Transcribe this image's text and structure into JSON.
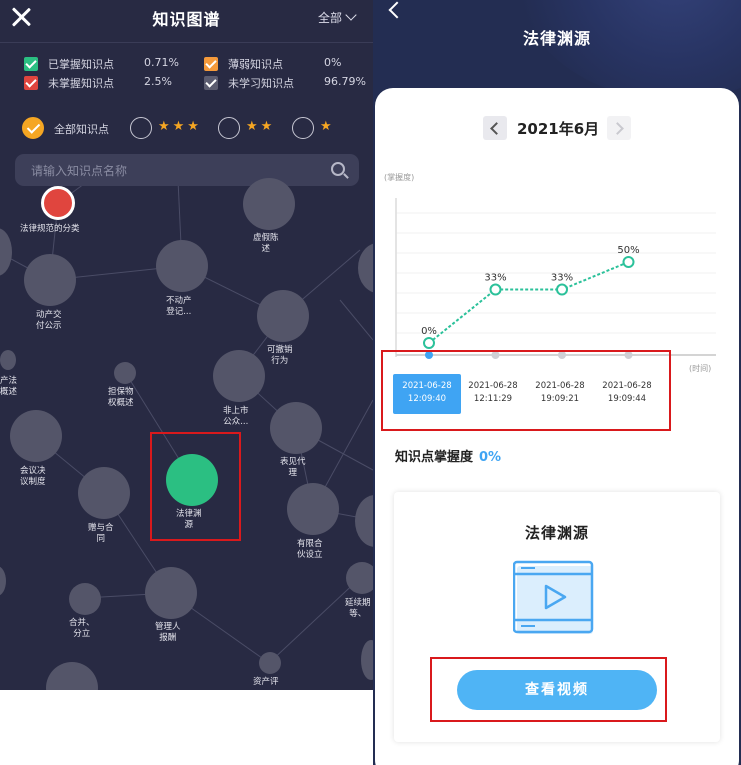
{
  "left": {
    "title": "知识图谱",
    "filter": "全部",
    "legend": [
      {
        "label": "已掌握知识点",
        "pct": "0.71%",
        "color": "#2bbf82"
      },
      {
        "label": "薄弱知识点",
        "pct": "0%",
        "color": "#f59a3b"
      },
      {
        "label": "未掌握知识点",
        "pct": "2.5%",
        "color": "#e0453e"
      },
      {
        "label": "未学习知识点",
        "pct": "96.79%",
        "color": "#5b5c70"
      }
    ],
    "levels": [
      {
        "label": "全部知识点",
        "selected": true
      },
      {
        "stars": "★★★",
        "count": 3
      },
      {
        "stars": "★★",
        "count": 2
      },
      {
        "stars": "★",
        "count": 1
      }
    ],
    "search_placeholder": "请输入知识点名称",
    "nodes": [
      {
        "label": "法律规范的分类"
      },
      {
        "label": "虚假陈\n述"
      },
      {
        "label": "动产交\n付公示"
      },
      {
        "label": "不动产\n登记..."
      },
      {
        "label": "可撤销\n行为"
      },
      {
        "label": "担保物\n权概述"
      },
      {
        "label": "非上市\n公众..."
      },
      {
        "label": "产法\n概述"
      },
      {
        "label": "会议决\n议制度"
      },
      {
        "label": "赠与合\n同"
      },
      {
        "label": "法律渊\n源"
      },
      {
        "label": "表见代\n理"
      },
      {
        "label": "有限合\n伙设立"
      },
      {
        "label": "合并、\n分立"
      },
      {
        "label": "管理人\n报酬"
      },
      {
        "label": "资产评"
      },
      {
        "label": "延续期\n等、"
      }
    ]
  },
  "right": {
    "title": "法律渊源",
    "month": "2021年6月",
    "ylabel": "(掌握度)",
    "xlabel": "(时间)",
    "times": [
      {
        "date": "2021-06-28",
        "time": "12:09:40"
      },
      {
        "date": "2021-06-28",
        "time": "12:11:29"
      },
      {
        "date": "2021-06-28",
        "time": "19:09:21"
      },
      {
        "date": "2021-06-28",
        "time": "19:09:44"
      }
    ],
    "mastery_label": "知识点掌握度",
    "mastery_value": "0%",
    "video_title": "法律渊源",
    "watch_button": "查看视频"
  },
  "chart_data": {
    "type": "line",
    "categories": [
      "2021-06-28 12:09:40",
      "2021-06-28 12:11:29",
      "2021-06-28 19:09:21",
      "2021-06-28 19:09:44"
    ],
    "values": [
      0,
      33,
      33,
      50
    ],
    "point_labels": [
      "0%",
      "33%",
      "33%",
      "50%"
    ],
    "xlabel": "(时间)",
    "ylabel": "(掌握度)",
    "ylim": [
      0,
      100
    ],
    "color": "#2bc19a"
  }
}
